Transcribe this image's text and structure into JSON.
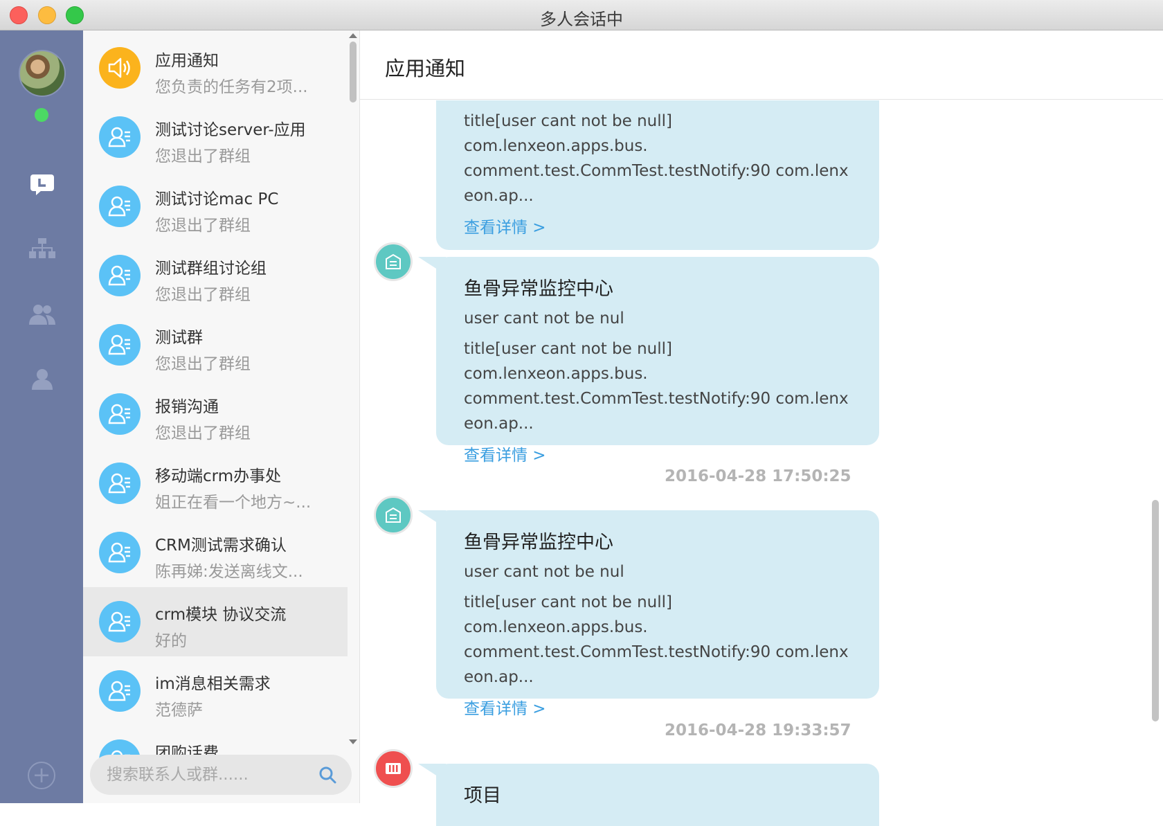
{
  "window": {
    "title": "多人会话中"
  },
  "rail": {
    "items": [
      {
        "icon": "chat-icon",
        "active": true
      },
      {
        "icon": "org-chart-icon",
        "active": false
      },
      {
        "icon": "contacts-icon",
        "active": false
      },
      {
        "icon": "profile-icon",
        "active": false
      }
    ],
    "add_label": "+"
  },
  "conversations": [
    {
      "name": "应用通知",
      "preview": "您负责的任务有2项...",
      "type": "notify"
    },
    {
      "name": "测试讨论server-应用",
      "preview": "您退出了群组",
      "type": "group"
    },
    {
      "name": "测试讨论mac PC",
      "preview": "您退出了群组",
      "type": "group"
    },
    {
      "name": "测试群组讨论组",
      "preview": "您退出了群组",
      "type": "group"
    },
    {
      "name": "测试群",
      "preview": "您退出了群组",
      "type": "group"
    },
    {
      "name": "报销沟通",
      "preview": "您退出了群组",
      "type": "group"
    },
    {
      "name": "移动端crm办事处",
      "preview": "姐正在看一个地方~...",
      "type": "group"
    },
    {
      "name": "CRM测试需求确认",
      "preview": "陈再娣:发送离线文...",
      "type": "group"
    },
    {
      "name": "crm模块 协议交流",
      "preview": "好的",
      "type": "group",
      "selected": true
    },
    {
      "name": "im消息相关需求",
      "preview": "范德萨",
      "type": "group"
    },
    {
      "name": "团购话费",
      "preview": "",
      "type": "group"
    }
  ],
  "search": {
    "placeholder": "搜索联系人或群......"
  },
  "chat": {
    "title": "应用通知",
    "messages": [
      {
        "title": "",
        "subtitle": "",
        "body": [
          "title[user cant not be null] com.lenxeon.apps.bus.",
          "comment.test.CommTest.testNotify:90 com.lenx",
          "eon.ap..."
        ],
        "link": "查看详情 >"
      },
      {
        "title": "鱼骨异常监控中心",
        "subtitle": "user cant not be nul",
        "body": [
          "title[user cant not be null] com.lenxeon.apps.bus.",
          "comment.test.CommTest.testNotify:90 com.lenx",
          "eon.ap..."
        ],
        "link": "查看详情 >"
      },
      {
        "timestamp": "2016-04-28 17:50:25",
        "title": "鱼骨异常监控中心",
        "subtitle": "user cant not be nul",
        "body": [
          "title[user cant not be null] com.lenxeon.apps.bus.",
          "comment.test.CommTest.testNotify:90 com.lenx",
          "eon.ap..."
        ],
        "link": "查看详情 >"
      },
      {
        "timestamp": "2016-04-28 19:33:57",
        "title": "项目"
      }
    ]
  },
  "colors": {
    "rail": "#6d7ba3",
    "bubble": "#d5ecf4",
    "link": "#3a9ee0",
    "online": "#4cd964"
  }
}
